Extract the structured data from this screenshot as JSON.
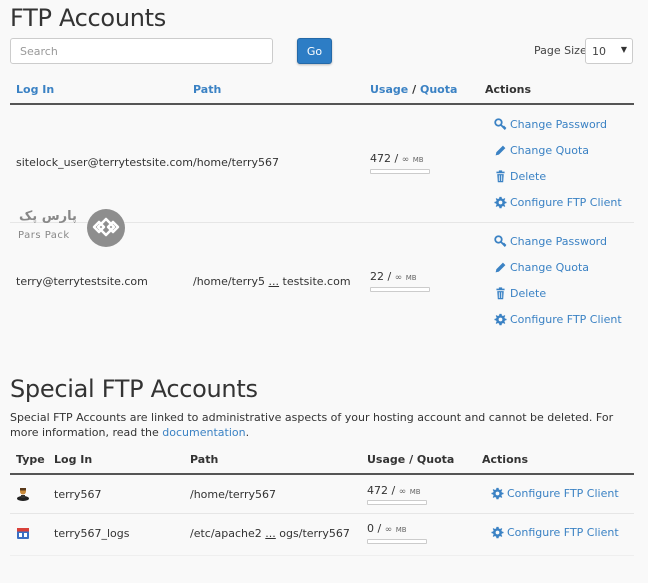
{
  "ftp_accounts": {
    "title": "FTP Accounts",
    "search": {
      "placeholder": "Search",
      "value": ""
    },
    "go_label": "Go",
    "page_size": {
      "label": "Page Size",
      "value": "10"
    },
    "columns": {
      "login": "Log In",
      "path": "Path",
      "usage": "Usage",
      "separator": "/",
      "quota": "Quota",
      "actions": "Actions"
    },
    "rows": [
      {
        "login": "sitelock_user@terrytestsite.com",
        "path_start": "/home/terry567",
        "path_ellipsis": "",
        "path_end": "",
        "usage": "472",
        "quota_symbol": "∞",
        "unit": "MB",
        "usage_fraction": 0
      },
      {
        "login": "terry@terrytestsite.com",
        "path_start": "/home/terry5",
        "path_ellipsis": "...",
        "path_end": "testsite.com",
        "usage": "22",
        "quota_symbol": "∞",
        "unit": "MB",
        "usage_fraction": 0
      }
    ],
    "actions": {
      "change_password": "Change Password",
      "change_quota": "Change Quota",
      "delete": "Delete",
      "configure": "Configure FTP Client"
    }
  },
  "special_ftp_accounts": {
    "title": "Special FTP Accounts",
    "description": "Special FTP Accounts are linked to administrative aspects of your hosting account and cannot be deleted. For more information, read the ",
    "doc_link": "documentation",
    "description_end": ".",
    "columns": {
      "type": "Type",
      "login": "Log In",
      "path": "Path",
      "usage_quota": "Usage / Quota",
      "actions": "Actions"
    },
    "rows": [
      {
        "type_icon": "user-icon",
        "login": "terry567",
        "path_start": "/home/terry567",
        "path_ellipsis": "",
        "path_end": "",
        "usage": "472",
        "quota_symbol": "∞",
        "unit": "MB",
        "action": "Configure FTP Client"
      },
      {
        "type_icon": "logs-calendar-icon",
        "login": "terry567_logs",
        "path_start": "/etc/apache2",
        "path_ellipsis": "...",
        "path_end": "ogs/terry567",
        "usage": "0",
        "quota_symbol": "∞",
        "unit": "MB",
        "action": "Configure FTP Client"
      }
    ]
  },
  "watermark": {
    "text_fa": "پارس پک",
    "text_en": "Pars Pack"
  },
  "colors": {
    "accent": "#3b82c4",
    "button": "#2d7dc5",
    "background": "#f9f9f9"
  }
}
